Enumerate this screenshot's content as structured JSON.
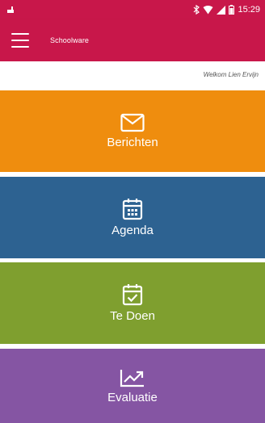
{
  "status_bar": {
    "time": "15:29",
    "icons": [
      "notification-icon",
      "bluetooth-icon",
      "wifi-icon",
      "signal-icon",
      "battery-icon"
    ]
  },
  "app_bar": {
    "title": "Schoolware",
    "menu_icon": "hamburger-menu-icon"
  },
  "welcome": "Welkom Lien Ervijn",
  "tiles": [
    {
      "label": "Berichten",
      "icon": "envelope-icon",
      "color": "#ef8d0e"
    },
    {
      "label": "Agenda",
      "icon": "calendar-icon",
      "color": "#2d6291"
    },
    {
      "label": "Te Doen",
      "icon": "calendar-check-icon",
      "color": "#7f9f2f"
    },
    {
      "label": "Evaluatie",
      "icon": "trend-chart-icon",
      "color": "#8555a3"
    }
  ],
  "colors": {
    "brand": "#c8174a"
  }
}
